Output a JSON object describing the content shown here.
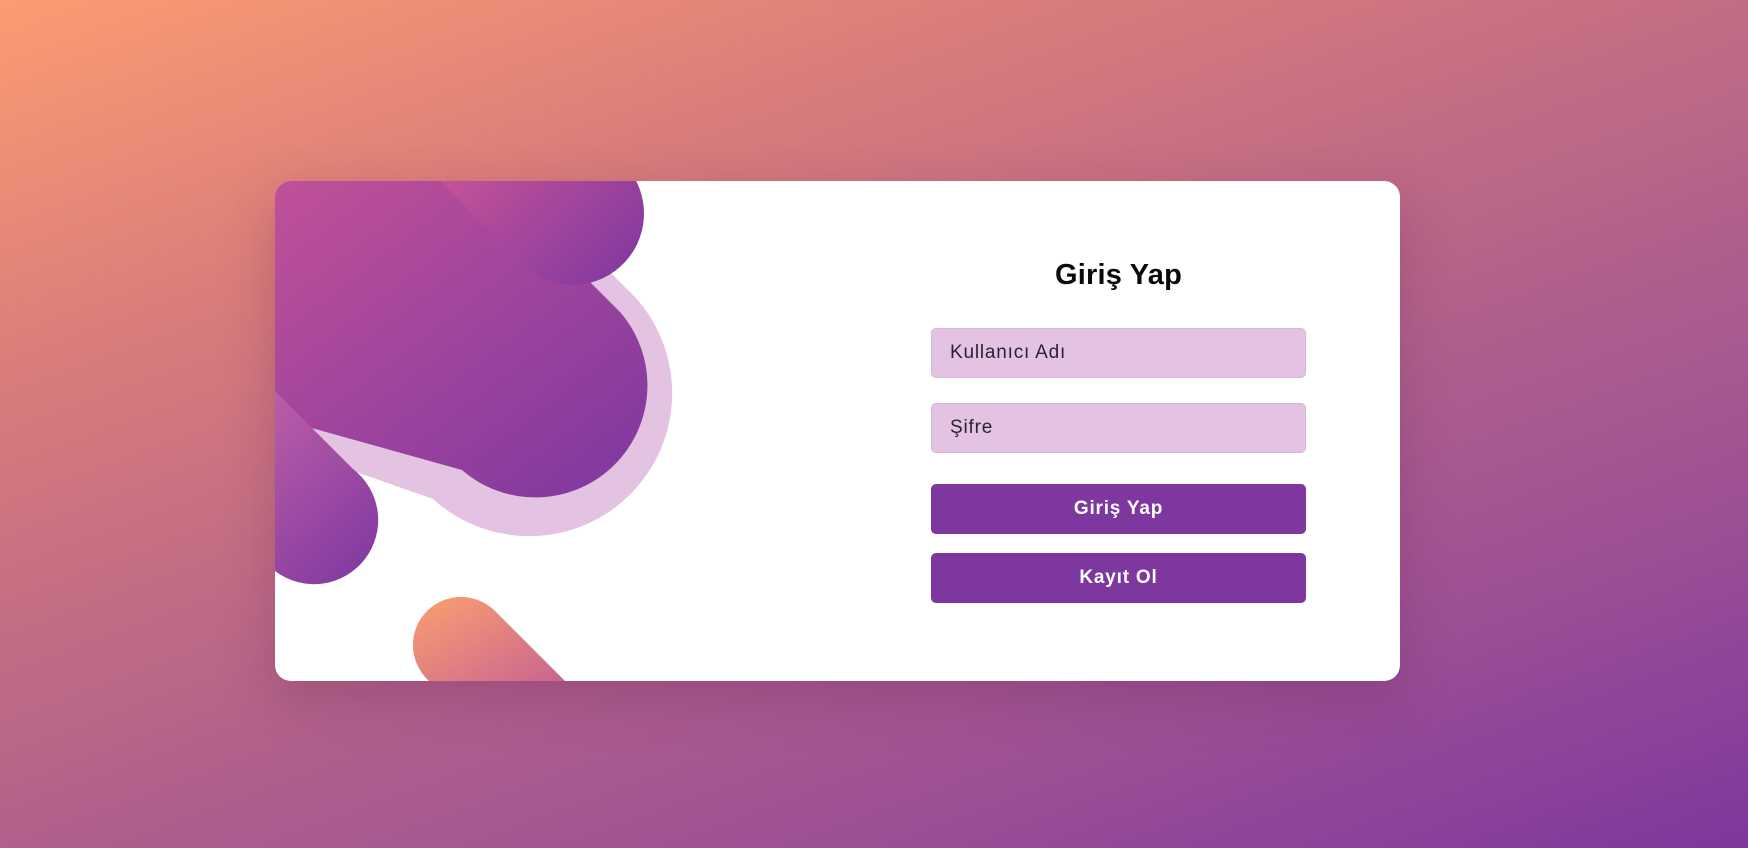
{
  "login": {
    "title": "Giriş Yap",
    "username_placeholder": "Kullanıcı Adı",
    "password_placeholder": "Şifre",
    "login_button": "Giriş Yap",
    "register_button": "Kayıt Ol"
  },
  "colors": {
    "background_start": "#fb9c72",
    "background_end": "#7d379d",
    "card": "#ffffff",
    "input_fill": "#e3c3e1",
    "button": "#7e379e",
    "shape_pink": "#e05d95",
    "shape_purple": "#7d37a0",
    "shape_lilac": "#e3c3e1",
    "shape_peach": "#fba06f"
  }
}
